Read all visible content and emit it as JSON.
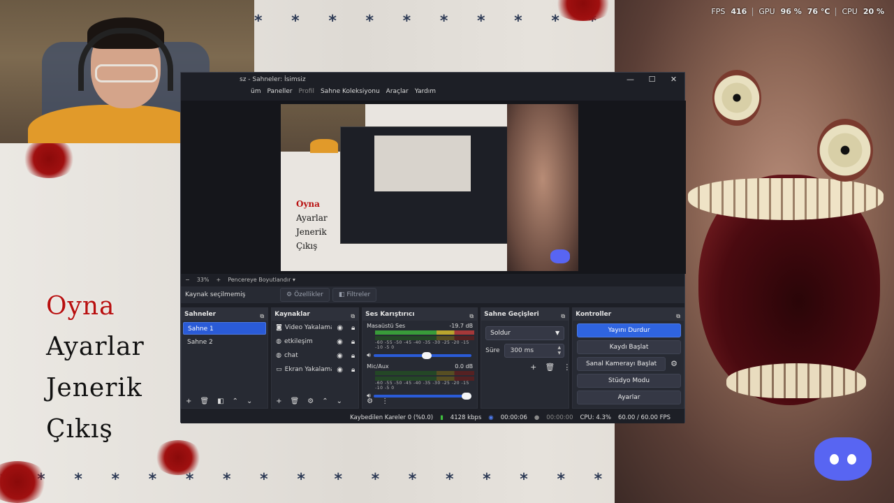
{
  "perf": {
    "fps_label": "FPS",
    "fps": "416",
    "gpu_label": "GPU",
    "gpu_usage": "96 %",
    "gpu_temp": "76 °C",
    "cpu_label": "CPU",
    "cpu": "20 %"
  },
  "overlay_menu": {
    "play": "Oyna",
    "settings": "Ayarlar",
    "credits": "Jenerik",
    "exit": "Çıkış"
  },
  "obs": {
    "title": "sz - Sahneler: İsimsiz",
    "menu": [
      "üm",
      "Paneller",
      "Profil",
      "Sahne Koleksiyonu",
      "Araçlar",
      "Yardım"
    ],
    "window_controls": {
      "minimize": "—",
      "maximize": "☐",
      "close": "✕"
    },
    "zoom": {
      "minus": "−",
      "value": "33%",
      "plus": "+",
      "fit": "Pencereye Boyutlandır"
    },
    "source_bar": {
      "none_selected": "Kaynak seçilmemiş",
      "properties": "Özellikler",
      "filters": "Filtreler"
    },
    "scenes": {
      "title": "Sahneler",
      "items": [
        "Sahne 1",
        "Sahne 2"
      ]
    },
    "sources": {
      "title": "Kaynaklar",
      "items": [
        {
          "name": "Video Yakalama",
          "icon": "camera-icon"
        },
        {
          "name": "etkileşim",
          "icon": "globe-icon"
        },
        {
          "name": "chat",
          "icon": "globe-icon"
        },
        {
          "name": "Ekran Yakalama",
          "icon": "monitor-icon"
        }
      ]
    },
    "mixer": {
      "title": "Ses Karıştırıcı",
      "channels": [
        {
          "name": "Masaüstü Ses",
          "db": "-19.7 dB",
          "level": 0.62,
          "volume": 0.55
        },
        {
          "name": "Mic/Aux",
          "db": "0.0 dB",
          "level": 0.3,
          "volume": 1.0
        }
      ],
      "scale": "-60 -55 -50 -45 -40 -35 -30 -25 -20 -15 -10 -5 0"
    },
    "transitions": {
      "title": "Sahne Geçişleri",
      "selected": "Soldur",
      "duration_label": "Süre",
      "duration": "300 ms"
    },
    "controls": {
      "title": "Kontroller",
      "stop_stream": "Yayını Durdur",
      "start_recording": "Kaydı Başlat",
      "start_virtualcam": "Sanal Kamerayı Başlat",
      "studio_mode": "Stüdyo Modu",
      "settings": "Ayarlar"
    },
    "status": {
      "dropped": "Kaybedilen Kareler 0 (%0.0)",
      "bitrate": "4128 kbps",
      "stream_time": "00:00:06",
      "rec_time": "00:00:00",
      "cpu": "CPU: 4.3%",
      "fps": "60.00 / 60.00 FPS"
    }
  },
  "colors": {
    "accent": "#2f64e0",
    "blood": "#a01010",
    "discord": "#5865f2"
  }
}
